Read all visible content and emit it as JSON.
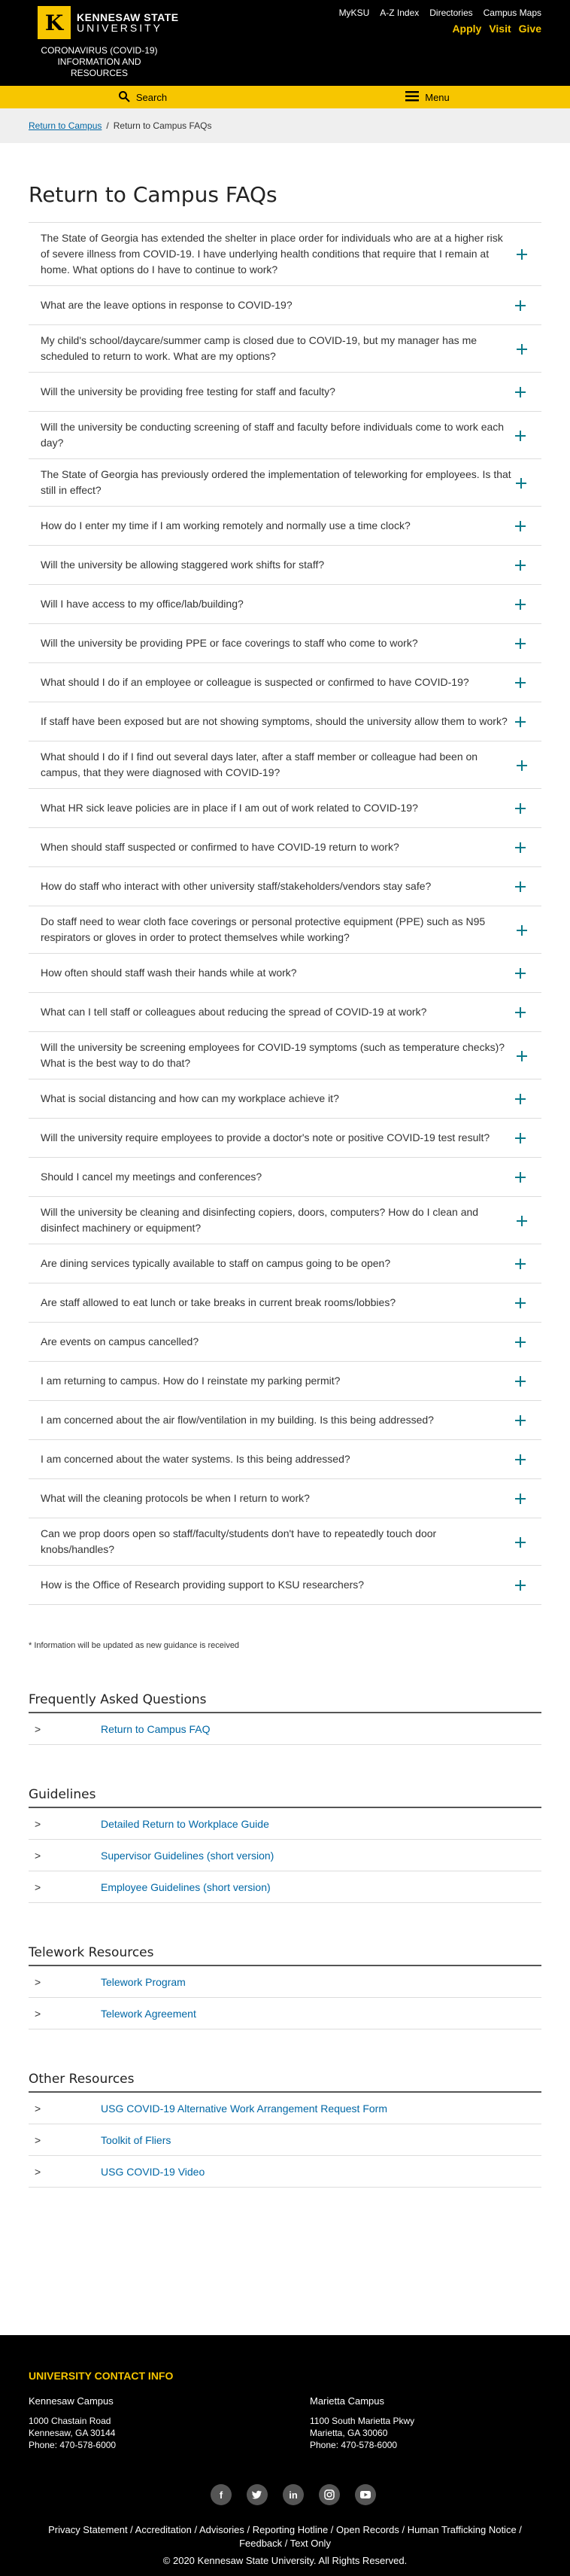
{
  "header": {
    "logo_line1": "KENNESAW STATE",
    "logo_line2": "UNIVERSITY",
    "covid_title": "CORONAVIRUS (COVID-19) INFORMATION AND RESOURCES",
    "top_links": [
      "MyKSU",
      "A-Z Index",
      "Directories",
      "Campus Maps"
    ],
    "actions": [
      "Apply",
      "Visit",
      "Give"
    ]
  },
  "utility_bar": {
    "search_label": "Search",
    "menu_label": "Menu"
  },
  "breadcrumb": {
    "home": "Return to Campus",
    "separator": "/",
    "current": "Return to Campus FAQs"
  },
  "page_title": "Return to Campus FAQs",
  "faqs": [
    "The State of Georgia has extended the shelter in place order for individuals who are at a higher risk of severe illness from COVID-19. I have underlying health conditions that require that I remain at home. What options do I have to continue to work?",
    "What are the leave options in response to COVID-19?",
    "My child's school/daycare/summer camp is closed due to COVID-19, but my manager has me scheduled to return to work. What are my options?",
    "Will the university be providing free testing for staff and faculty?",
    "Will the university be conducting screening of staff and faculty before individuals come to work each day?",
    "The State of Georgia has previously ordered the implementation of teleworking for employees. Is that still in effect?",
    "How do I enter my time if I am working remotely and normally use a time clock?",
    "Will the university be allowing staggered work shifts for staff?",
    "Will I have access to my office/lab/building?",
    "Will the university be providing PPE or face coverings to staff who come to work?",
    "What should I do if an employee or colleague is suspected or confirmed to have COVID-19?",
    "If staff have been exposed but are not showing symptoms, should the university allow them to work?",
    "What should I do if I find out several days later, after a staff member or colleague had been on campus, that they were diagnosed with COVID-19?",
    "What HR sick leave policies are in place if I am out of work related to COVID-19?",
    "When should staff suspected or confirmed to have COVID-19 return to work?",
    "How do staff who interact with other university staff/stakeholders/vendors stay safe?",
    "Do staff need to wear cloth face coverings or personal protective equipment (PPE) such as N95 respirators or gloves in order to protect themselves while working?",
    "How often should staff wash their hands while at work?",
    "What can I tell staff or colleagues about reducing the spread of COVID-19 at work?",
    "Will the university be screening employees for COVID-19 symptoms (such as temperature checks)? What is the best way to do that?",
    "What is social distancing and how can my workplace achieve it?",
    "Will the university require employees to provide a doctor's note or positive COVID-19 test result?",
    "Should I cancel my meetings and conferences?",
    "Will the university be cleaning and disinfecting copiers, doors, computers? How do I clean and disinfect machinery or equipment?",
    "Are dining services typically available to staff on campus going to be open?",
    "Are staff allowed to eat lunch or take breaks in current break rooms/lobbies?",
    "Are events on campus cancelled?",
    "I am returning to campus.  How do I reinstate my parking permit?",
    "I am concerned about the air flow/ventilation in my building. Is this being addressed?",
    "I am concerned about the water systems. Is this being addressed?",
    "What will the cleaning protocols be when I return to work?",
    "Can we prop doors open so staff/faculty/students don't have to repeatedly touch door knobs/handles?",
    "How is the Office of Research providing support to KSU researchers?"
  ],
  "note": "* Information will be updated as new guidance is received",
  "sections": [
    {
      "title": "Frequently Asked Questions",
      "links": [
        "Return to Campus FAQ"
      ]
    },
    {
      "title": "Guidelines",
      "links": [
        "Detailed Return to Workplace Guide",
        "Supervisor Guidelines (short version)",
        "Employee Guidelines (short version)"
      ]
    },
    {
      "title": "Telework Resources",
      "links": [
        "Telework Program",
        "Telework Agreement"
      ]
    },
    {
      "title": "Other Resources",
      "links": [
        "USG COVID-19 Alternative Work Arrangement Request Form",
        "Toolkit of Fliers",
        "USG COVID-19 Video"
      ]
    }
  ],
  "chevron": ">",
  "footer": {
    "title": "UNIVERSITY CONTACT INFO",
    "campuses": [
      {
        "name": "Kennesaw Campus",
        "address1": "1000 Chastain Road",
        "address2": "Kennesaw, GA 30144",
        "phone": "Phone: 470-578-6000"
      },
      {
        "name": "Marietta Campus",
        "address1": "1100 South Marietta Pkwy",
        "address2": "Marietta, GA 30060",
        "phone": "Phone: 470-578-6000"
      }
    ],
    "social_icons": [
      "facebook-icon",
      "twitter-icon",
      "linkedin-icon",
      "instagram-icon",
      "youtube-icon"
    ],
    "policies": "Privacy Statement / Accreditation / Advisories / Reporting Hotline / Open Records / Human Trafficking Notice / Feedback / Text Only",
    "copyright": "© 2020 Kennesaw State University. All Rights Reserved."
  },
  "colors": {
    "brand_yellow": "#f7c600",
    "link_blue": "#0067a5",
    "plus_teal": "#0a7a8a"
  }
}
